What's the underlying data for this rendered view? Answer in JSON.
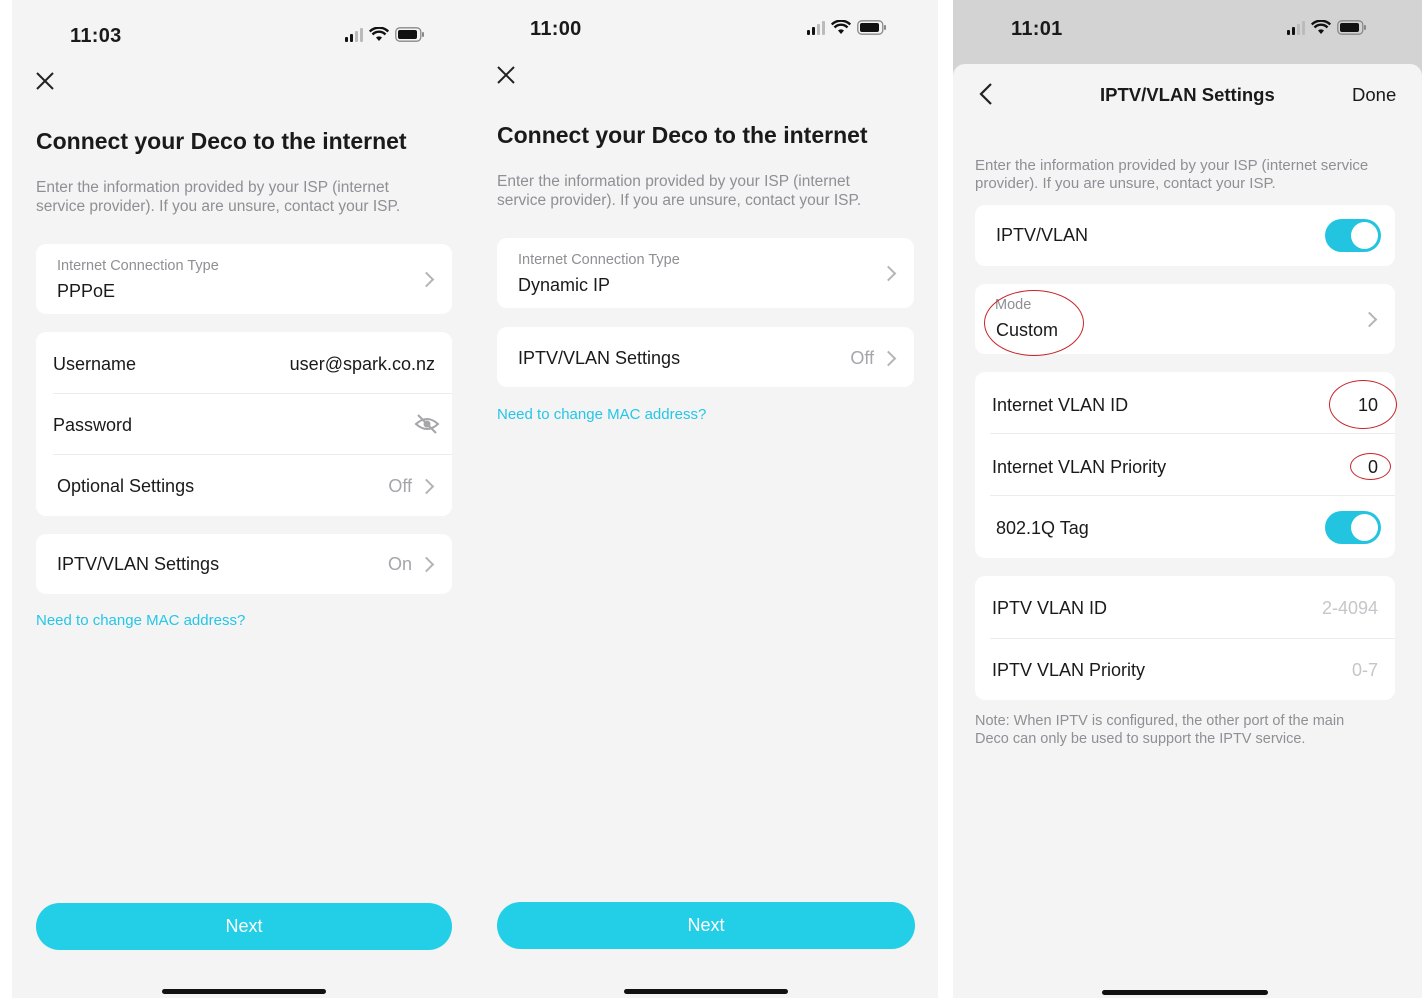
{
  "screen1": {
    "time": "11:03",
    "title": "Connect your Deco to the internet",
    "description": "Enter the information provided by your ISP (internet\nservice provider). If you are unsure, contact your ISP.",
    "connection_type_label": "Internet Connection Type",
    "connection_type_value": "PPPoE",
    "username_label": "Username",
    "username_value": "user@spark.co.nz",
    "password_label": "Password",
    "optional_label": "Optional Settings",
    "optional_value": "Off",
    "iptv_label": "IPTV/VLAN Settings",
    "iptv_value": "On",
    "mac_link": "Need to change MAC address?",
    "next_label": "Next"
  },
  "screen2": {
    "time": "11:00",
    "title": "Connect your Deco to the internet",
    "description": "Enter the information provided by your ISP (internet\nservice provider). If you are unsure, contact your ISP.",
    "connection_type_label": "Internet Connection Type",
    "connection_type_value": "Dynamic IP",
    "iptv_label": "IPTV/VLAN Settings",
    "iptv_value": "Off",
    "mac_link": "Need to change MAC address?",
    "next_label": "Next"
  },
  "screen3": {
    "time": "11:01",
    "nav_title": "IPTV/VLAN Settings",
    "done_label": "Done",
    "description": "Enter the information provided by your ISP (internet service\nprovider). If you are unsure, contact your ISP.",
    "iptv_vlan_label": "IPTV/VLAN",
    "iptv_vlan_on": true,
    "mode_label": "Mode",
    "mode_value": "Custom",
    "internet_vlan_id_label": "Internet VLAN ID",
    "internet_vlan_id_value": "10",
    "internet_vlan_priority_label": "Internet VLAN Priority",
    "internet_vlan_priority_value": "0",
    "tag_label": "802.1Q Tag",
    "tag_on": true,
    "iptv_vlan_id_label": "IPTV VLAN ID",
    "iptv_vlan_id_placeholder": "2-4094",
    "iptv_vlan_priority_label": "IPTV VLAN Priority",
    "iptv_vlan_priority_placeholder": "0-7",
    "note": "Note: When IPTV is configured, the other port of the main\nDeco can only be used to support the IPTV service."
  },
  "colors": {
    "accent": "#22cfe6",
    "link": "#25c6e6",
    "annotation": "#c8242a"
  },
  "icons": [
    "signal-icon",
    "wifi-icon",
    "battery-icon",
    "close-icon",
    "chevron-right-icon",
    "eye-hidden-icon",
    "back-icon"
  ]
}
